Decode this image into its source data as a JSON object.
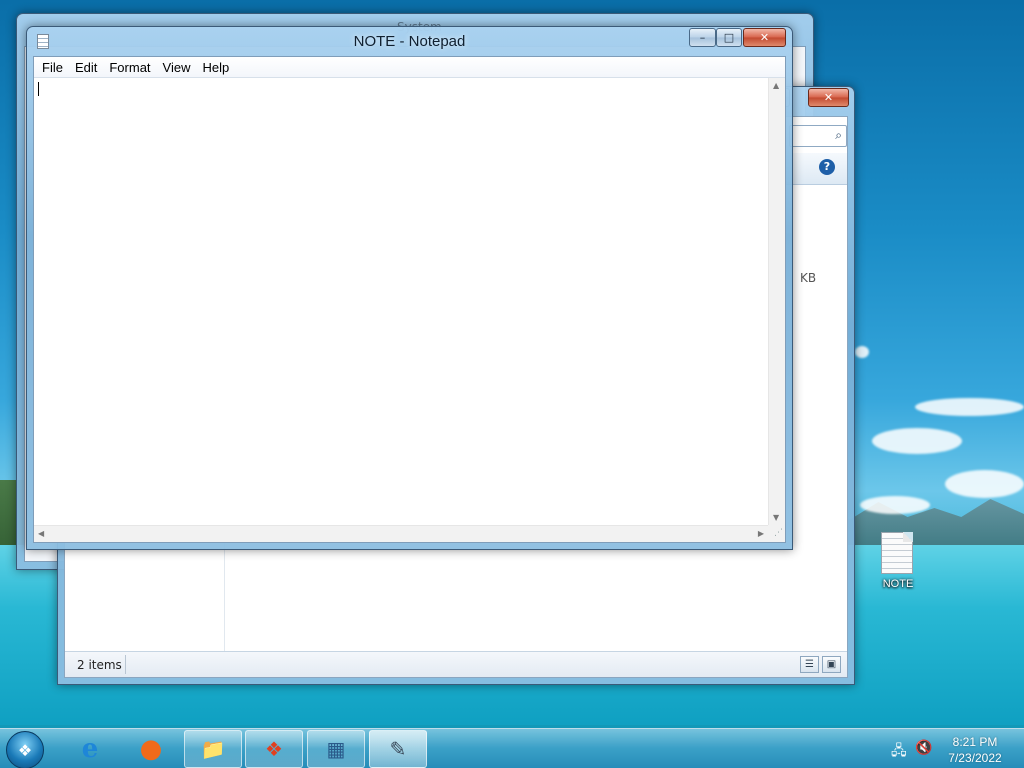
{
  "desktop": {
    "icons": [
      {
        "label": "NOTE",
        "type": "text-file-icon"
      }
    ]
  },
  "system_window": {
    "title": "System"
  },
  "explorer_window": {
    "size_fragment": "KB",
    "status_text": "2 items",
    "buttons": {
      "minimize": "–",
      "maximize": "□",
      "close": "✕"
    }
  },
  "notepad": {
    "title": "NOTE - Notepad",
    "menu": [
      "File",
      "Edit",
      "Format",
      "View",
      "Help"
    ],
    "content": "",
    "buttons": {
      "minimize": "–",
      "maximize": "□",
      "close": "✕"
    }
  },
  "taskbar": {
    "items": [
      {
        "name": "internet-explorer-icon",
        "glyph": "e",
        "open": false
      },
      {
        "name": "firefox-icon",
        "glyph": "●",
        "open": false
      },
      {
        "name": "file-explorer-icon",
        "glyph": "📁",
        "open": true
      },
      {
        "name": "windows-flag-icon",
        "glyph": "❖",
        "open": true
      },
      {
        "name": "control-panel-icon",
        "glyph": "▦",
        "open": true
      },
      {
        "name": "notepad-icon",
        "glyph": "✎",
        "open": true,
        "active": true
      }
    ],
    "clock": {
      "time": "8:21 PM",
      "date": "7/23/2022"
    }
  },
  "colors": {
    "accent": "#1a8cc6",
    "taskbar": "#3ca0c8",
    "close_button": "#c24a30"
  }
}
